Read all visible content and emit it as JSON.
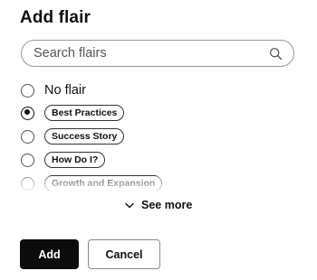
{
  "dialog": {
    "title": "Add flair"
  },
  "search": {
    "placeholder": "Search flairs",
    "value": "",
    "icon": "search-icon"
  },
  "options": [
    {
      "label": "No flair",
      "type": "text",
      "selected": false
    },
    {
      "label": "Best Practices",
      "type": "chip",
      "selected": true
    },
    {
      "label": "Success Story",
      "type": "chip",
      "selected": false
    },
    {
      "label": "How Do I?",
      "type": "chip",
      "selected": false
    },
    {
      "label": "Growth and Expansion",
      "type": "chip",
      "selected": false
    }
  ],
  "see_more": {
    "label": "See more",
    "icon": "chevron-down-icon"
  },
  "actions": {
    "add_label": "Add",
    "cancel_label": "Cancel"
  }
}
